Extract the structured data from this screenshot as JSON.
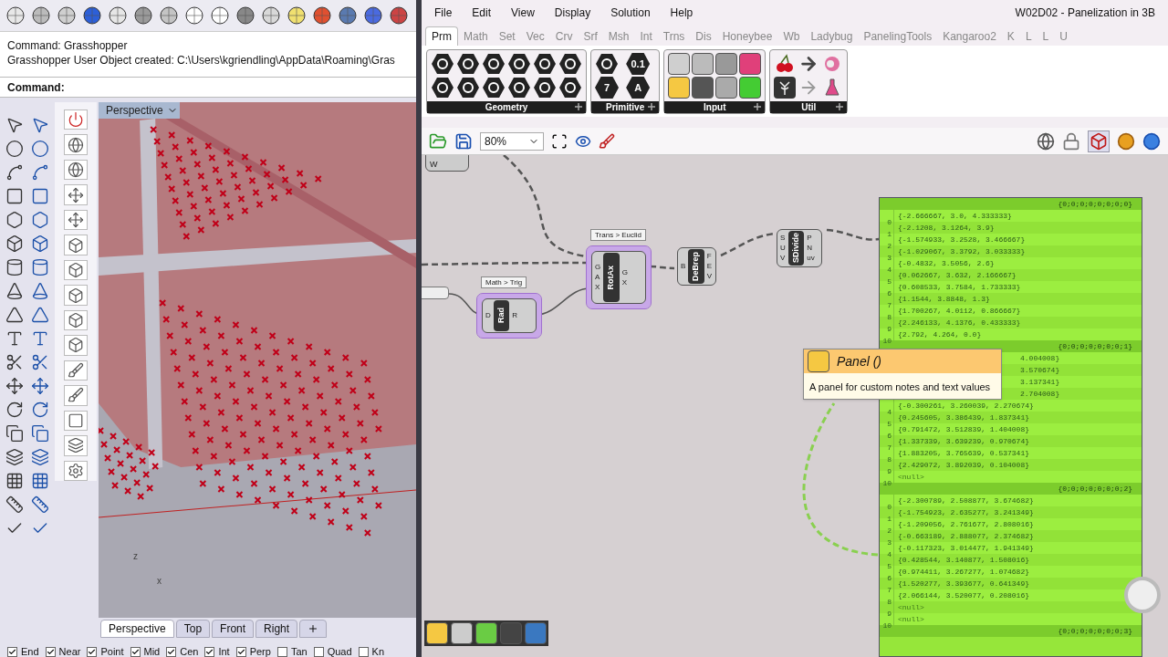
{
  "rhino": {
    "command_history": [
      "Command: Grasshopper",
      "Grasshopper User Object created: C:\\Users\\kgriendling\\AppData\\Roaming\\Gras"
    ],
    "command_prompt": "Command:",
    "viewport": {
      "title": "Perspective",
      "axis_labels": [
        "z",
        "x"
      ]
    },
    "viewport_tabs": [
      {
        "label": "Perspective",
        "selected": true
      },
      {
        "label": "Top",
        "selected": false
      },
      {
        "label": "Front",
        "selected": false
      },
      {
        "label": "Right",
        "selected": false
      }
    ],
    "osnaps": [
      {
        "label": "End",
        "checked": true
      },
      {
        "label": "Near",
        "checked": true
      },
      {
        "label": "Point",
        "checked": true
      },
      {
        "label": "Mid",
        "checked": true
      },
      {
        "label": "Cen",
        "checked": true
      },
      {
        "label": "Int",
        "checked": true
      },
      {
        "label": "Perp",
        "checked": true
      },
      {
        "label": "Tan",
        "checked": false
      },
      {
        "label": "Quad",
        "checked": false
      },
      {
        "label": "Kn",
        "checked": false
      }
    ]
  },
  "grasshopper": {
    "title": "W02D02 - Panelization in 3B",
    "menu": [
      "File",
      "Edit",
      "View",
      "Display",
      "Solution",
      "Help"
    ],
    "tabs": [
      {
        "label": "Prm",
        "selected": true
      },
      {
        "label": "Math",
        "selected": false
      },
      {
        "label": "Set",
        "selected": false
      },
      {
        "label": "Vec",
        "selected": false
      },
      {
        "label": "Crv",
        "selected": false
      },
      {
        "label": "Srf",
        "selected": false
      },
      {
        "label": "Msh",
        "selected": false
      },
      {
        "label": "Int",
        "selected": false
      },
      {
        "label": "Trns",
        "selected": false
      },
      {
        "label": "Dis",
        "selected": false
      },
      {
        "label": "Honeybee",
        "selected": false
      },
      {
        "label": "Wb",
        "selected": false
      },
      {
        "label": "Ladybug",
        "selected": false
      },
      {
        "label": "PanelingTools",
        "selected": false
      },
      {
        "label": "Kangaroo2",
        "selected": false
      },
      {
        "label": "K",
        "selected": false
      },
      {
        "label": "L",
        "selected": false
      },
      {
        "label": "L",
        "selected": false
      },
      {
        "label": "U",
        "selected": false
      }
    ],
    "ribbon_groups": [
      "Geometry",
      "Primitive",
      "Input",
      "Util"
    ],
    "primitive_glyphs": [
      "0.1",
      "7",
      "A"
    ],
    "zoom": "80%",
    "partial_component": {
      "label": "W"
    },
    "components": [
      {
        "name": "Rad",
        "inputs": [
          "D"
        ],
        "outputs": [
          "R"
        ],
        "tag": "Math > Trig",
        "highlighted": true
      },
      {
        "name": "RotAx",
        "inputs": [
          "G",
          "A",
          "X"
        ],
        "outputs": [
          "G",
          "X"
        ],
        "tag": "Trans > Euclid",
        "highlighted": true
      },
      {
        "name": "DeBrep",
        "inputs": [
          "B"
        ],
        "outputs": [
          "F",
          "E",
          "V"
        ],
        "highlighted": false
      },
      {
        "name": "SDivide",
        "inputs": [
          "S",
          "U",
          "V"
        ],
        "outputs": [
          "P",
          "N",
          "uv"
        ],
        "highlighted": false
      }
    ],
    "panel": {
      "branches": [
        {
          "path": "{0;0;0;0;0;0;0;0}",
          "items": [
            {
              "kind": "full",
              "index": "0",
              "value": "{-2.666667, 3.0, 4.333333}"
            },
            {
              "kind": "full",
              "index": "1",
              "value": "{-2.1208, 3.1264, 3.9}"
            },
            {
              "kind": "full",
              "index": "2",
              "value": "{-1.574933, 3.2528, 3.466667}"
            },
            {
              "kind": "full",
              "index": "3",
              "value": "{-1.029067, 3.3792, 3.033333}"
            },
            {
              "kind": "full",
              "index": "4",
              "value": "{-0.4832, 3.5056, 2.6}"
            },
            {
              "kind": "full",
              "index": "5",
              "value": "{0.062667, 3.632, 2.166667}"
            },
            {
              "kind": "full",
              "index": "6",
              "value": "{0.608533, 3.7584, 1.733333}"
            },
            {
              "kind": "full",
              "index": "7",
              "value": "{1.1544, 3.8848, 1.3}"
            },
            {
              "kind": "full",
              "index": "8",
              "value": "{1.700267, 4.0112, 0.866667}"
            },
            {
              "kind": "full",
              "index": "9",
              "value": "{2.246133, 4.1376, 0.433333}"
            },
            {
              "kind": "full",
              "index": "10",
              "value": "{2.792, 4.264, 0.0}"
            }
          ]
        },
        {
          "path": "{0;0;0;0;0;0;0;1}",
          "items": [
            {
              "kind": "partial",
              "value": "4.004008}"
            },
            {
              "kind": "partial",
              "value": "3.570674}"
            },
            {
              "kind": "partial",
              "value": "3.137341}"
            },
            {
              "kind": "partial",
              "value": "2.704008}"
            },
            {
              "kind": "full",
              "index": "4",
              "value": "{-0.300261, 3.260039, 2.270674}"
            },
            {
              "kind": "full",
              "index": "5",
              "value": "{0.245605, 3.386439, 1.837341}"
            },
            {
              "kind": "full",
              "index": "6",
              "value": "{0.791472, 3.512839, 1.404008}"
            },
            {
              "kind": "full",
              "index": "7",
              "value": "{1.337339, 3.639239, 0.970674}"
            },
            {
              "kind": "full",
              "index": "8",
              "value": "{1.883205, 3.765639, 0.537341}"
            },
            {
              "kind": "full",
              "index": "9",
              "value": "{2.429072, 3.892039, 0.104008}"
            },
            {
              "kind": "null",
              "index": "10",
              "value": "<null>"
            }
          ]
        },
        {
          "path": "{0;0;0;0;0;0;0;2}",
          "items": [
            {
              "kind": "full",
              "index": "0",
              "value": "{-2.300789, 2.508877, 3.674682}"
            },
            {
              "kind": "full",
              "index": "1",
              "value": "{-1.754923, 2.635277, 3.241349}"
            },
            {
              "kind": "full",
              "index": "2",
              "value": "{-1.209056, 2.761677, 2.808016}"
            },
            {
              "kind": "full",
              "index": "3",
              "value": "{-0.663189, 2.888077, 2.374682}"
            },
            {
              "kind": "full",
              "index": "4",
              "value": "{-0.117323, 3.014477, 1.941349}"
            },
            {
              "kind": "full",
              "index": "5",
              "value": "{0.428544, 3.140877, 1.508016}"
            },
            {
              "kind": "full",
              "index": "6",
              "value": "{0.974411, 3.267277, 1.074682}"
            },
            {
              "kind": "full",
              "index": "7",
              "value": "{1.520277, 3.393677, 0.641349}"
            },
            {
              "kind": "full",
              "index": "8",
              "value": "{2.066144, 3.520077, 0.208016}"
            },
            {
              "kind": "null",
              "index": "9",
              "value": "<null>"
            },
            {
              "kind": "null",
              "index": "10",
              "value": "<null>"
            }
          ]
        },
        {
          "path": "{0;0;0;0;0;0;0;3}"
        }
      ]
    },
    "tooltip": {
      "title": "Panel ()",
      "text": "A panel for custom notes and text values"
    }
  }
}
